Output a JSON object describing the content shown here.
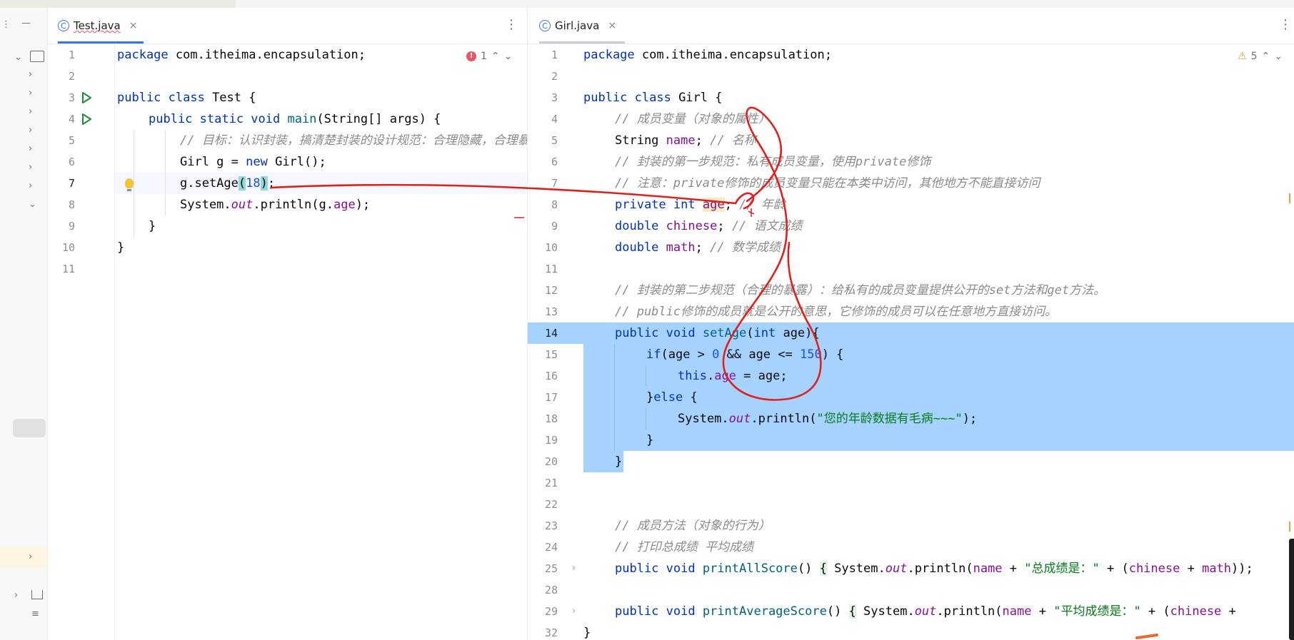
{
  "left_editor": {
    "tab": {
      "icon": "class-icon",
      "icon_glyph": "C",
      "name": "Test.java",
      "close": "×"
    },
    "problems": {
      "count": "1"
    },
    "lines": [
      {
        "n": "1"
      },
      {
        "n": "2"
      },
      {
        "n": "3"
      },
      {
        "n": "4"
      },
      {
        "n": "5"
      },
      {
        "n": "6"
      },
      {
        "n": "7"
      },
      {
        "n": "8"
      },
      {
        "n": "9"
      },
      {
        "n": "10"
      },
      {
        "n": "11"
      }
    ]
  },
  "right_editor": {
    "tab": {
      "icon": "class-icon",
      "icon_glyph": "C",
      "name": "Girl.java",
      "close": "×"
    },
    "warnings": {
      "count": "5"
    },
    "lines": [
      {
        "n": "1"
      },
      {
        "n": "2"
      },
      {
        "n": "3"
      },
      {
        "n": "4"
      },
      {
        "n": "5"
      },
      {
        "n": "6"
      },
      {
        "n": "7"
      },
      {
        "n": "8"
      },
      {
        "n": "9"
      },
      {
        "n": "10"
      },
      {
        "n": "11"
      },
      {
        "n": "12"
      },
      {
        "n": "13"
      },
      {
        "n": "14"
      },
      {
        "n": "15"
      },
      {
        "n": "16"
      },
      {
        "n": "17"
      },
      {
        "n": "18"
      },
      {
        "n": "19"
      },
      {
        "n": "20"
      },
      {
        "n": "21"
      },
      {
        "n": "22"
      },
      {
        "n": "23"
      },
      {
        "n": "24"
      },
      {
        "n": "25"
      },
      {
        "n": "28"
      },
      {
        "n": "29"
      },
      {
        "n": "32"
      }
    ]
  },
  "code_text": {
    "l1_kw": "package",
    "l1_rest": " com.itheima.encapsulation;",
    "l3_kw1": "public class",
    "l3_rest": " Test {",
    "l4_kw1": "public static void",
    "l4_mt": " main",
    "l4_rest": "(String[] args) {",
    "l5_cm": "// 目标：认识封装，搞清楚封装的设计规范：合理隐藏，合理暴露。",
    "l6_a": "Girl g = ",
    "l6_kw": "new",
    "l6_b": " Girl();",
    "l7_a": "g.setAge",
    "l7_p1": "(",
    "l7_num": "18",
    "l7_p2": ")",
    "l7_b": ";",
    "l8_a": "System.",
    "l8_out": "out",
    "l8_b": ".println(g.",
    "l8_fd": "age",
    "l8_c": ");",
    "l9": "}",
    "l10": "}",
    "r1_kw": "package",
    "r1_rest": " com.itheima.encapsulation;",
    "r3_kw": "public class",
    "r3_rest": " Girl {",
    "r4_cm": "// 成员变量（对象的属性）",
    "r5_a": "String ",
    "r5_fd": "name",
    "r5_b": "; ",
    "r5_cm": "// 名称",
    "r6_cm": "// 封装的第一步规范：私有成员变量，使用private修饰",
    "r7_cm": "// 注意：private修饰的成员变量只能在本类中访问，其他地方不能直接访问",
    "r8_kw": "private int",
    "r8_sp": " ",
    "r8_fd": "age",
    "r8_b": "; ",
    "r8_cm": "// 年龄",
    "r9_kw": "double",
    "r9_sp": " ",
    "r9_fd": "chinese",
    "r9_b": "; ",
    "r9_cm": "// 语文成绩",
    "r10_kw": "double",
    "r10_sp": " ",
    "r10_fd": "math",
    "r10_b": "; ",
    "r10_cm": "// 数学成绩",
    "r12_cm": "// 封装的第二步规范（合理的暴露）：给私有的成员变量提供公开的set方法和get方法。",
    "r13_cm": "// public修饰的成员就是公开的意思，它修饰的成员可以在任意地方直接访问。",
    "r14_kw": "public void",
    "r14_mt": " setAge",
    "r14_a": "(",
    "r14_kw2": "int",
    "r14_b": " age){",
    "r15_kw": "if",
    "r15_a": "(age > ",
    "r15_n1": "0",
    "r15_b": " && age <= ",
    "r15_n2": "150",
    "r15_c": ") {",
    "r16_kw": "this",
    "r16_a": ".",
    "r16_fd": "age",
    "r16_b": " = age;",
    "r17_a": "}",
    "r17_kw": "else",
    "r17_b": " {",
    "r18_a": "System.",
    "r18_out": "out",
    "r18_b": ".println(",
    "r18_st": "\"您的年龄数据有毛病~~~\"",
    "r18_c": ");",
    "r19": "}",
    "r20": "}",
    "r23_cm": "// 成员方法（对象的行为）",
    "r24_cm": "// 打印总成绩 平均成绩",
    "r25_kw": "public void",
    "r25_mt": " printAllScore",
    "r25_a": "() ",
    "r25_br": "{",
    "r25_b": " System.",
    "r25_out": "out",
    "r25_c": ".println(",
    "r25_fd": "name",
    "r25_d": " + ",
    "r25_st": "\"总成绩是：\"",
    "r25_e": " + (",
    "r25_fd2": "chinese",
    "r25_f": " + ",
    "r25_fd3": "math",
    "r25_g": "));",
    "r29_kw": "public void",
    "r29_mt": " printAverageScore",
    "r29_a": "() ",
    "r29_br": "{",
    "r29_b": " System.",
    "r29_out": "out",
    "r29_c": ".println(",
    "r29_fd": "name",
    "r29_d": " + ",
    "r29_st": "\"平均成绩是：\"",
    "r29_e": " + (",
    "r29_fd2": "chinese",
    "r29_f": " + ",
    "r32": "}"
  },
  "colors": {
    "keyword": "#0033b3",
    "comment": "#8c8c8c",
    "field": "#871094",
    "string": "#067d17",
    "number": "#1750eb",
    "selection": "#a6d2ff",
    "annotation": "#e0201c"
  }
}
